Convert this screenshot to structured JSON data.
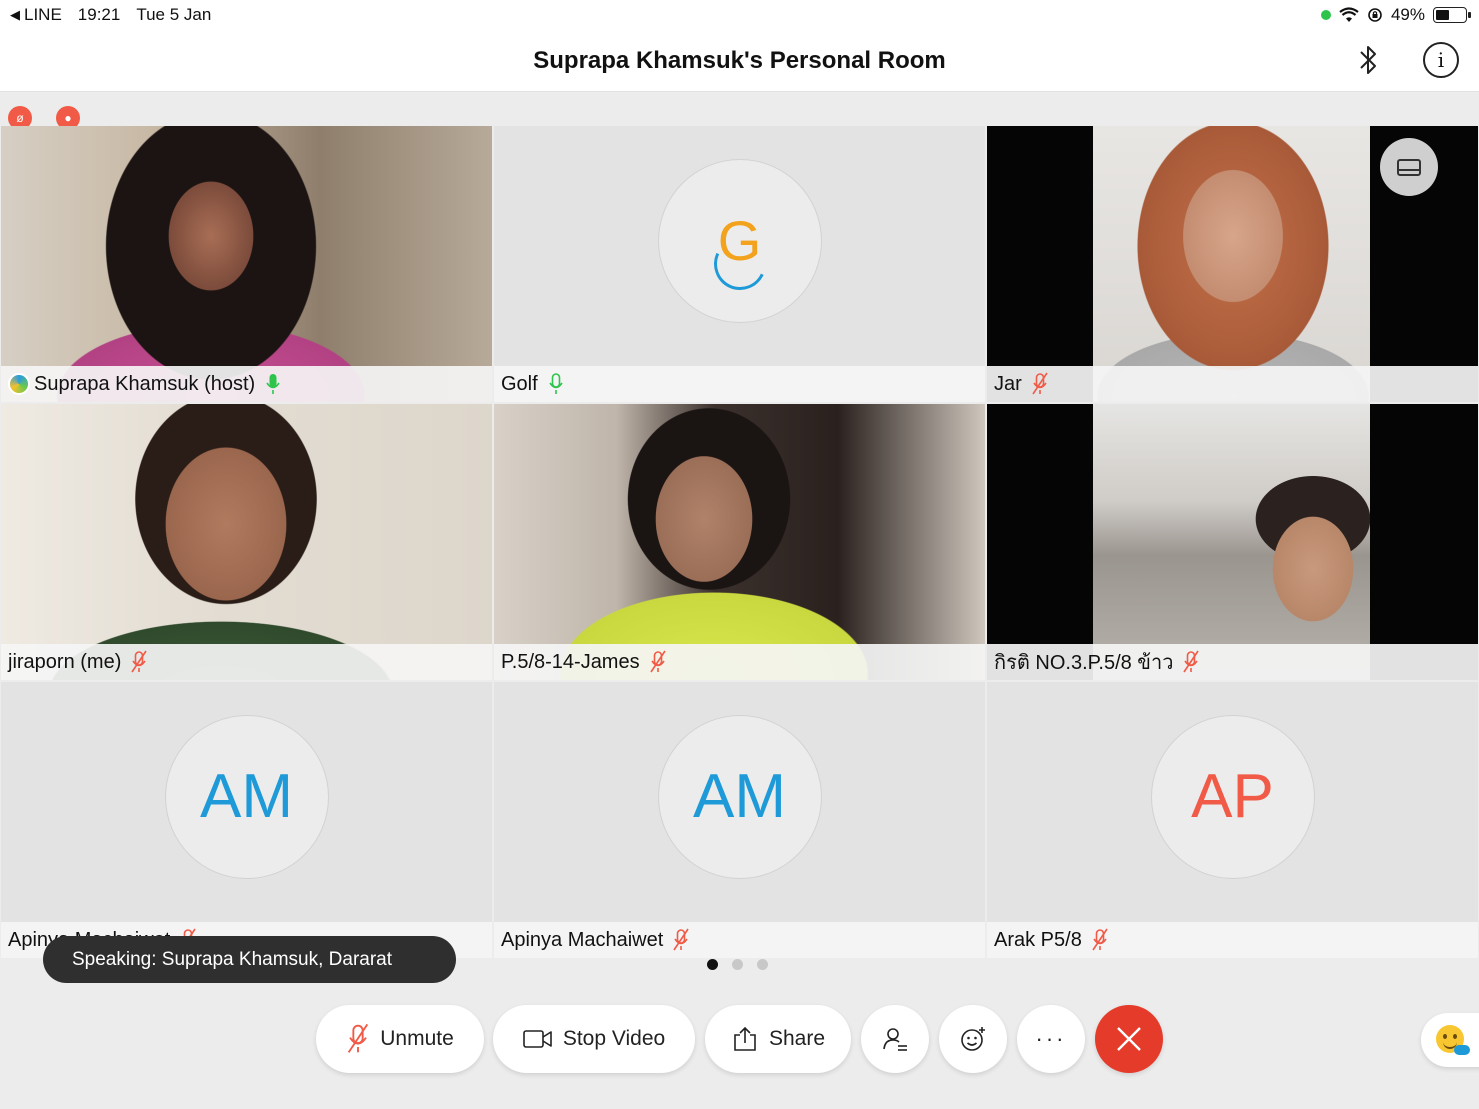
{
  "status_bar": {
    "back_app": "LINE",
    "time": "19:21",
    "date": "Tue 5 Jan",
    "battery_percent": "49%",
    "battery_level": 0.49
  },
  "header": {
    "title": "Suprapa Khamsuk's Personal Room"
  },
  "participants": [
    {
      "name": "Suprapa Khamsuk (host)",
      "video": true,
      "mic": "active",
      "active_speaker": true,
      "host_globe": true
    },
    {
      "name": "Golf",
      "video": false,
      "mic": "active",
      "initials": "G",
      "avatar_color": "#f2a21c",
      "connecting": true
    },
    {
      "name": "Jar",
      "video": true,
      "mic": "muted"
    },
    {
      "name": "jiraporn (me)",
      "video": true,
      "mic": "muted"
    },
    {
      "name": "P.5/8-14-James",
      "video": true,
      "mic": "muted"
    },
    {
      "name": "กิรติ NO.3.P.5/8 ข้าว",
      "video": true,
      "mic": "muted"
    },
    {
      "name": "Apinya Machaiwet",
      "video": false,
      "mic": "muted",
      "initials": "AM",
      "avatar_color": "#1e9ad8"
    },
    {
      "name": "Apinya Machaiwet",
      "video": false,
      "mic": "muted",
      "initials": "AM",
      "avatar_color": "#1e9ad8"
    },
    {
      "name": "Arak P5/8",
      "video": false,
      "mic": "muted",
      "initials": "AP",
      "avatar_color": "#f05a46"
    }
  ],
  "speaking_banner": "Speaking: Suprapa Khamsuk, Dararat",
  "pagination": {
    "pages": 3,
    "current": 1
  },
  "controls": {
    "unmute_label": "Unmute",
    "stop_video_label": "Stop Video",
    "share_label": "Share"
  },
  "colors": {
    "muted_mic": "#f05a46",
    "active_mic": "#2ec44b",
    "active_border": "#0b76b8",
    "end_button": "#e53b2b"
  }
}
